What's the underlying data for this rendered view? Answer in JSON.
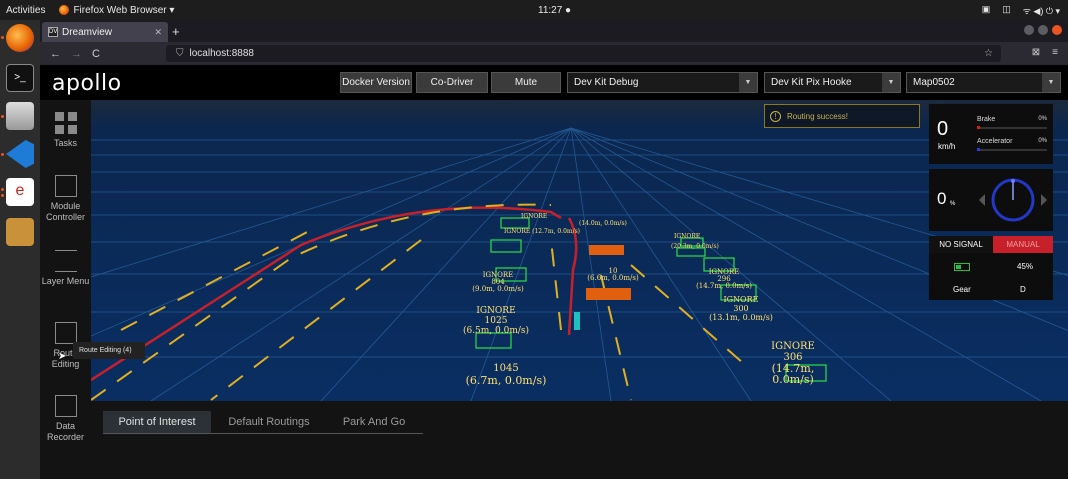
{
  "system": {
    "activities": "Activities",
    "app_menu": "Firefox Web Browser ▾",
    "clock": "11:27 ●",
    "tray": [
      "▣",
      "◫",
      "ᯤ ◀) ⏻ ▾"
    ]
  },
  "browser": {
    "tab_title": "Dreamview",
    "tab_favicon": "DV",
    "tab_close": "✕",
    "new_tab": "+",
    "url": "localhost:8888",
    "nav_icons": [
      "←",
      "→",
      "C"
    ],
    "bookmark_icon": "☆",
    "right_icons": [
      "⊠",
      "≡"
    ]
  },
  "dreamview": {
    "logo": "apollo",
    "header": {
      "docker_version": "Docker Version",
      "co_driver": "Co-Driver",
      "mute": "Mute",
      "mode_select": "Dev Kit Debug",
      "vehicle_select": "Dev Kit Pix Hooke",
      "map_select": "Map0502"
    },
    "sidenav": [
      {
        "id": "tasks",
        "label": "Tasks"
      },
      {
        "id": "module-controller",
        "label": "Module Controller"
      },
      {
        "id": "layer-menu",
        "label": "Layer Menu"
      },
      {
        "id": "route-editing",
        "label": "Route Editing"
      },
      {
        "id": "data-recorder",
        "label": "Data Recorder"
      }
    ],
    "tooltip": "Route Editing (4)",
    "toast": "Routing success!",
    "dashboard": {
      "speed_value": "0",
      "speed_unit": "km/h",
      "brake_label": "Brake",
      "brake_pct": "0%",
      "accelerator_label": "Accelerator",
      "accelerator_pct": "0%",
      "steering_value": "0",
      "steering_unit": "%",
      "signal": "NO SIGNAL",
      "drive_mode": "MANUAL",
      "battery_pct": "45%",
      "battery_level": 0.45,
      "gear_label": "Gear",
      "gear_value": "D"
    },
    "obstacles": [
      {
        "tag": "IGNORE",
        "id": "306",
        "info": "(14.7m, 0.0m/s)"
      },
      {
        "tag": "",
        "id": "1045",
        "info": "(6.7m, 0.0m/s)"
      },
      {
        "tag": "IGNORE",
        "id": "1025",
        "info": "(6.5m, 0.0m/s)"
      },
      {
        "tag": "IGNORE",
        "id": "804",
        "info": "(9.0m, 0.0m/s)"
      },
      {
        "tag": "IGNORE",
        "id": "300",
        "info": "(13.1m, 0.0m/s)"
      },
      {
        "tag": "IGNORE",
        "id": "296",
        "info": "(14.7m, 0.0m/s)"
      },
      {
        "tag": "",
        "id": "10",
        "info": "(6.6m, 0.0m/s)"
      }
    ],
    "bottom_tabs": [
      "Point of Interest",
      "Default Routings",
      "Park And Go"
    ]
  },
  "colors": {
    "accent_red": "#c8202a",
    "road_blue": "#0a2a58",
    "obstacle_green": "#28e045",
    "lane_yellow": "#e0b020"
  }
}
